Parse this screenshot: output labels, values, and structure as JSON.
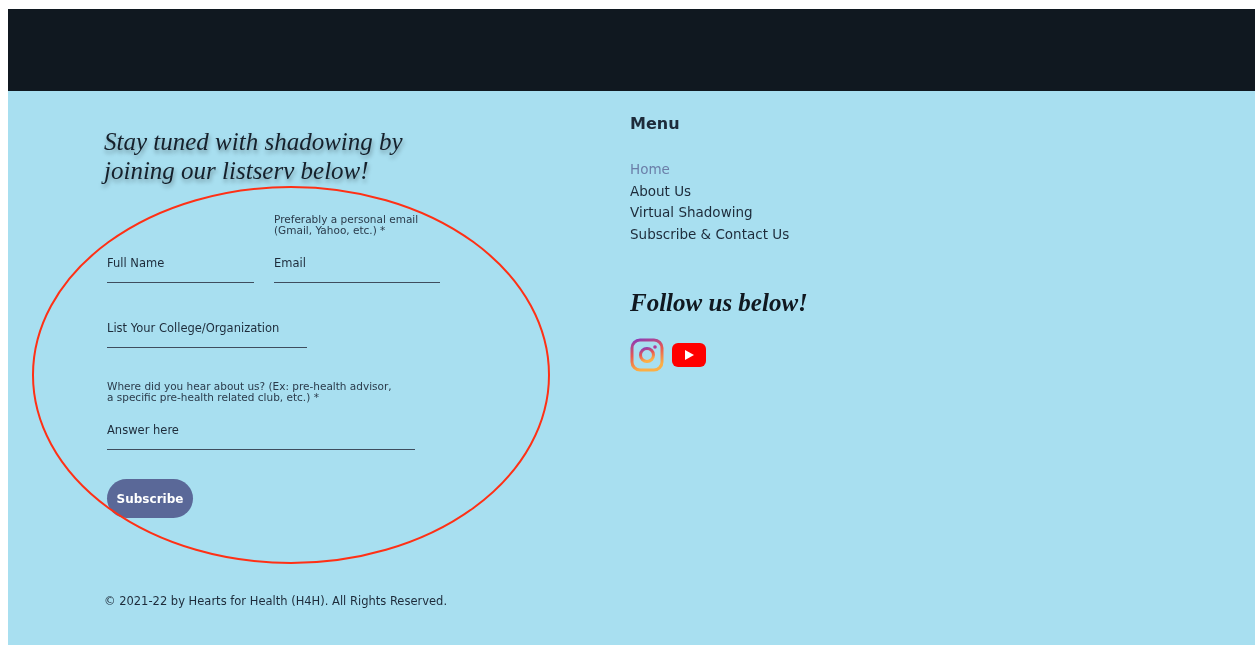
{
  "signup": {
    "heading_lines": [
      "Stay tuned with shadowing by",
      "joining our listserv below!"
    ],
    "fields": [
      {
        "kind": "half",
        "placeholder": "Full Name"
      },
      {
        "kind": "half",
        "label_lines": [
          "Preferably a personal email",
          "(Gmail, Yahoo, etc.) *"
        ],
        "placeholder": "Email"
      },
      {
        "kind": "full",
        "placeholder": "List Your College/Organization"
      },
      {
        "kind": "wide",
        "label_lines": [
          "Where did you hear about us? (Ex: pre-health advisor,",
          "a specific pre-health related club, etc.) *"
        ],
        "placeholder": "Answer here"
      }
    ],
    "button": "Subscribe"
  },
  "copyright": "© 2021-22 by Hearts for Health (H4H). All Rights Reserved.",
  "menu": {
    "title": "Menu",
    "items": [
      {
        "label": "Home",
        "selected": true
      },
      {
        "label": "About Us",
        "selected": false
      },
      {
        "label": "Virtual Shadowing",
        "selected": false
      },
      {
        "label": "Subscribe & Contact Us",
        "selected": false
      }
    ]
  },
  "social": {
    "heading": "Follow us below!",
    "links": [
      {
        "kind": "instagram"
      },
      {
        "kind": "youtube"
      }
    ]
  }
}
